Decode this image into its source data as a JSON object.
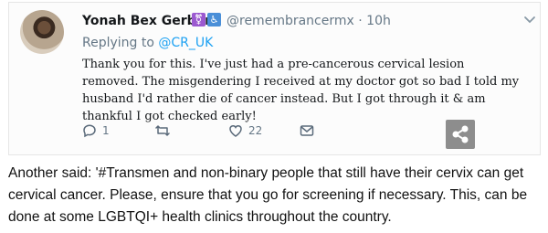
{
  "tweet": {
    "author_name": "Yonah Bex Gerber",
    "handle": "@remembrancermx",
    "separator": "·",
    "time": "10h",
    "replying_prefix": "Replying to",
    "replying_mention": "@CR_UK",
    "text": "Thank you for this. I've just had a pre-cancerous cervical lesion removed. The misgendering I received at my doctor got so bad I told my husband I'd rather die of cancer instead. But I got through it & am thankful I got checked early!",
    "reply_count": "1",
    "like_count": "22",
    "badges": [
      {
        "icon": "purple-badge-icon",
        "glyph": "⚧",
        "color": "#9b59d0"
      },
      {
        "icon": "accessibility-badge-icon",
        "glyph": "♿",
        "color": "#4a8fd8"
      }
    ]
  },
  "caption": "Another said: '#Transmen and non-binary people that still have their cervix can get cervical cancer. Please, ensure that you go for screening if necessary. This, can be done at some LGBTQI+ health clinics throughout the country."
}
